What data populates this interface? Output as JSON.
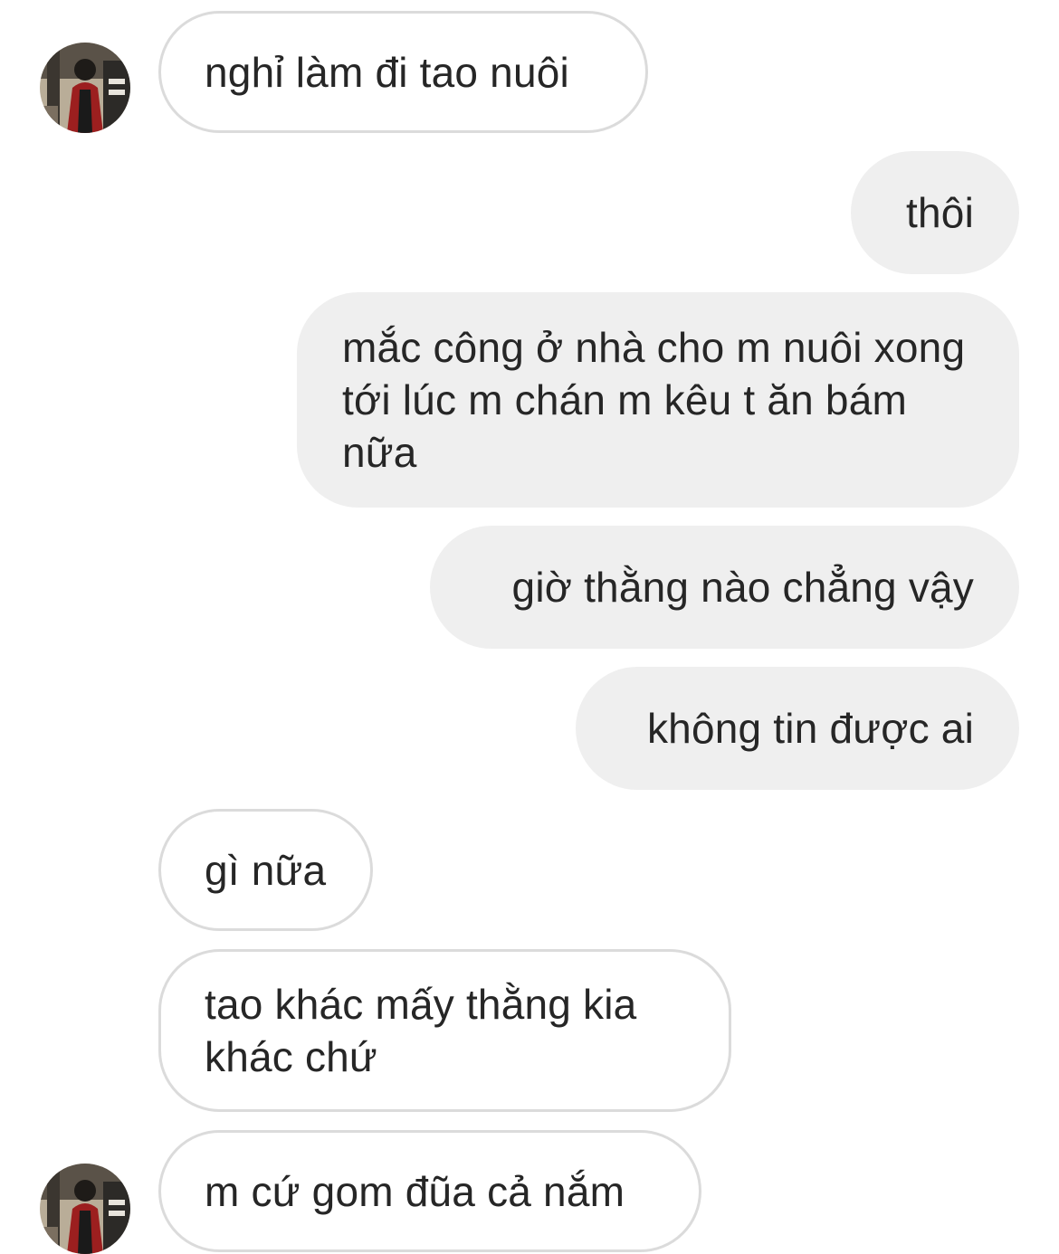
{
  "conversation": {
    "messages": [
      {
        "sender": "them",
        "text": "nghỉ làm đi tao nuôi"
      },
      {
        "sender": "me",
        "text": "thôi"
      },
      {
        "sender": "me",
        "text": "mắc công ở nhà cho m nuôi xong tới lúc m chán m kêu t ăn bám nữa"
      },
      {
        "sender": "me",
        "text": "giờ thằng nào chẳng vậy"
      },
      {
        "sender": "me",
        "text": "không tin được ai"
      },
      {
        "sender": "them",
        "text": "gì nữa"
      },
      {
        "sender": "them",
        "text": "tao khác mấy thằng kia khác chứ"
      },
      {
        "sender": "them",
        "text": "m cứ gom đũa cả nắm"
      }
    ]
  },
  "colors": {
    "incoming_border": "#dbdbdb",
    "outgoing_fill": "#efefef",
    "text": "#262626"
  }
}
